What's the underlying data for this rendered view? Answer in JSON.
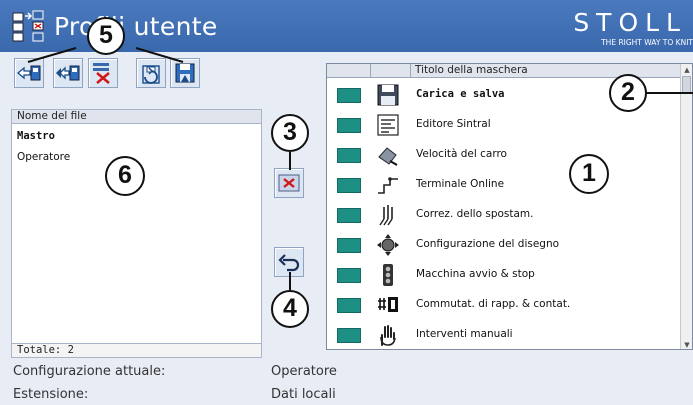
{
  "window": {
    "title": "Profili utente"
  },
  "brand": {
    "name": "STOLL",
    "tagline": "THE RIGHT WAY TO KNIT"
  },
  "toolbar": {
    "buttons": [
      {
        "icon": "load-arrow-icon"
      },
      {
        "icon": "import-arrow-icon"
      },
      {
        "icon": "delete-file-icon"
      },
      {
        "icon": "refresh-save-icon"
      },
      {
        "icon": "save-disk-icon"
      }
    ]
  },
  "file_list": {
    "header": "Nome del file",
    "items": [
      {
        "label": "Mastro",
        "bold": true
      },
      {
        "label": "Operatore",
        "bold": false
      }
    ],
    "footer": "Totale: 2"
  },
  "actions": {
    "delete_icon": "red-x-icon",
    "undo_icon": "undo-arrow-icon"
  },
  "masks_table": {
    "header_title": "Titolo della maschera",
    "swatch_color": "#1e8f84",
    "rows": [
      {
        "label": "Carica e salva",
        "bold": true,
        "icon": "floppy-disk-icon"
      },
      {
        "label": "Editore Sintral",
        "bold": false,
        "icon": "sintral-editor-icon"
      },
      {
        "label": "Velocità del carro",
        "bold": false,
        "icon": "carriage-speed-icon"
      },
      {
        "label": "Terminale Online",
        "bold": false,
        "icon": "online-terminal-icon"
      },
      {
        "label": "Correz. dello spostam.",
        "bold": false,
        "icon": "racking-correction-icon"
      },
      {
        "label": "Configurazione del disegno",
        "bold": false,
        "icon": "pattern-configuration-icon"
      },
      {
        "label": "Macchina avvio & stop",
        "bold": false,
        "icon": "traffic-light-icon"
      },
      {
        "label": "Commutat. di rapp. & contat.",
        "bold": false,
        "icon": "counter-switch-icon"
      },
      {
        "label": "Interventi manuali",
        "bold": false,
        "icon": "manual-hand-icon"
      }
    ]
  },
  "status": {
    "config_label": "Configurazione attuale:",
    "config_value": "Operatore",
    "ext_label": "Estensione:",
    "ext_value": "Dati locali"
  },
  "callouts": [
    "1",
    "2",
    "3",
    "4",
    "5",
    "6"
  ]
}
